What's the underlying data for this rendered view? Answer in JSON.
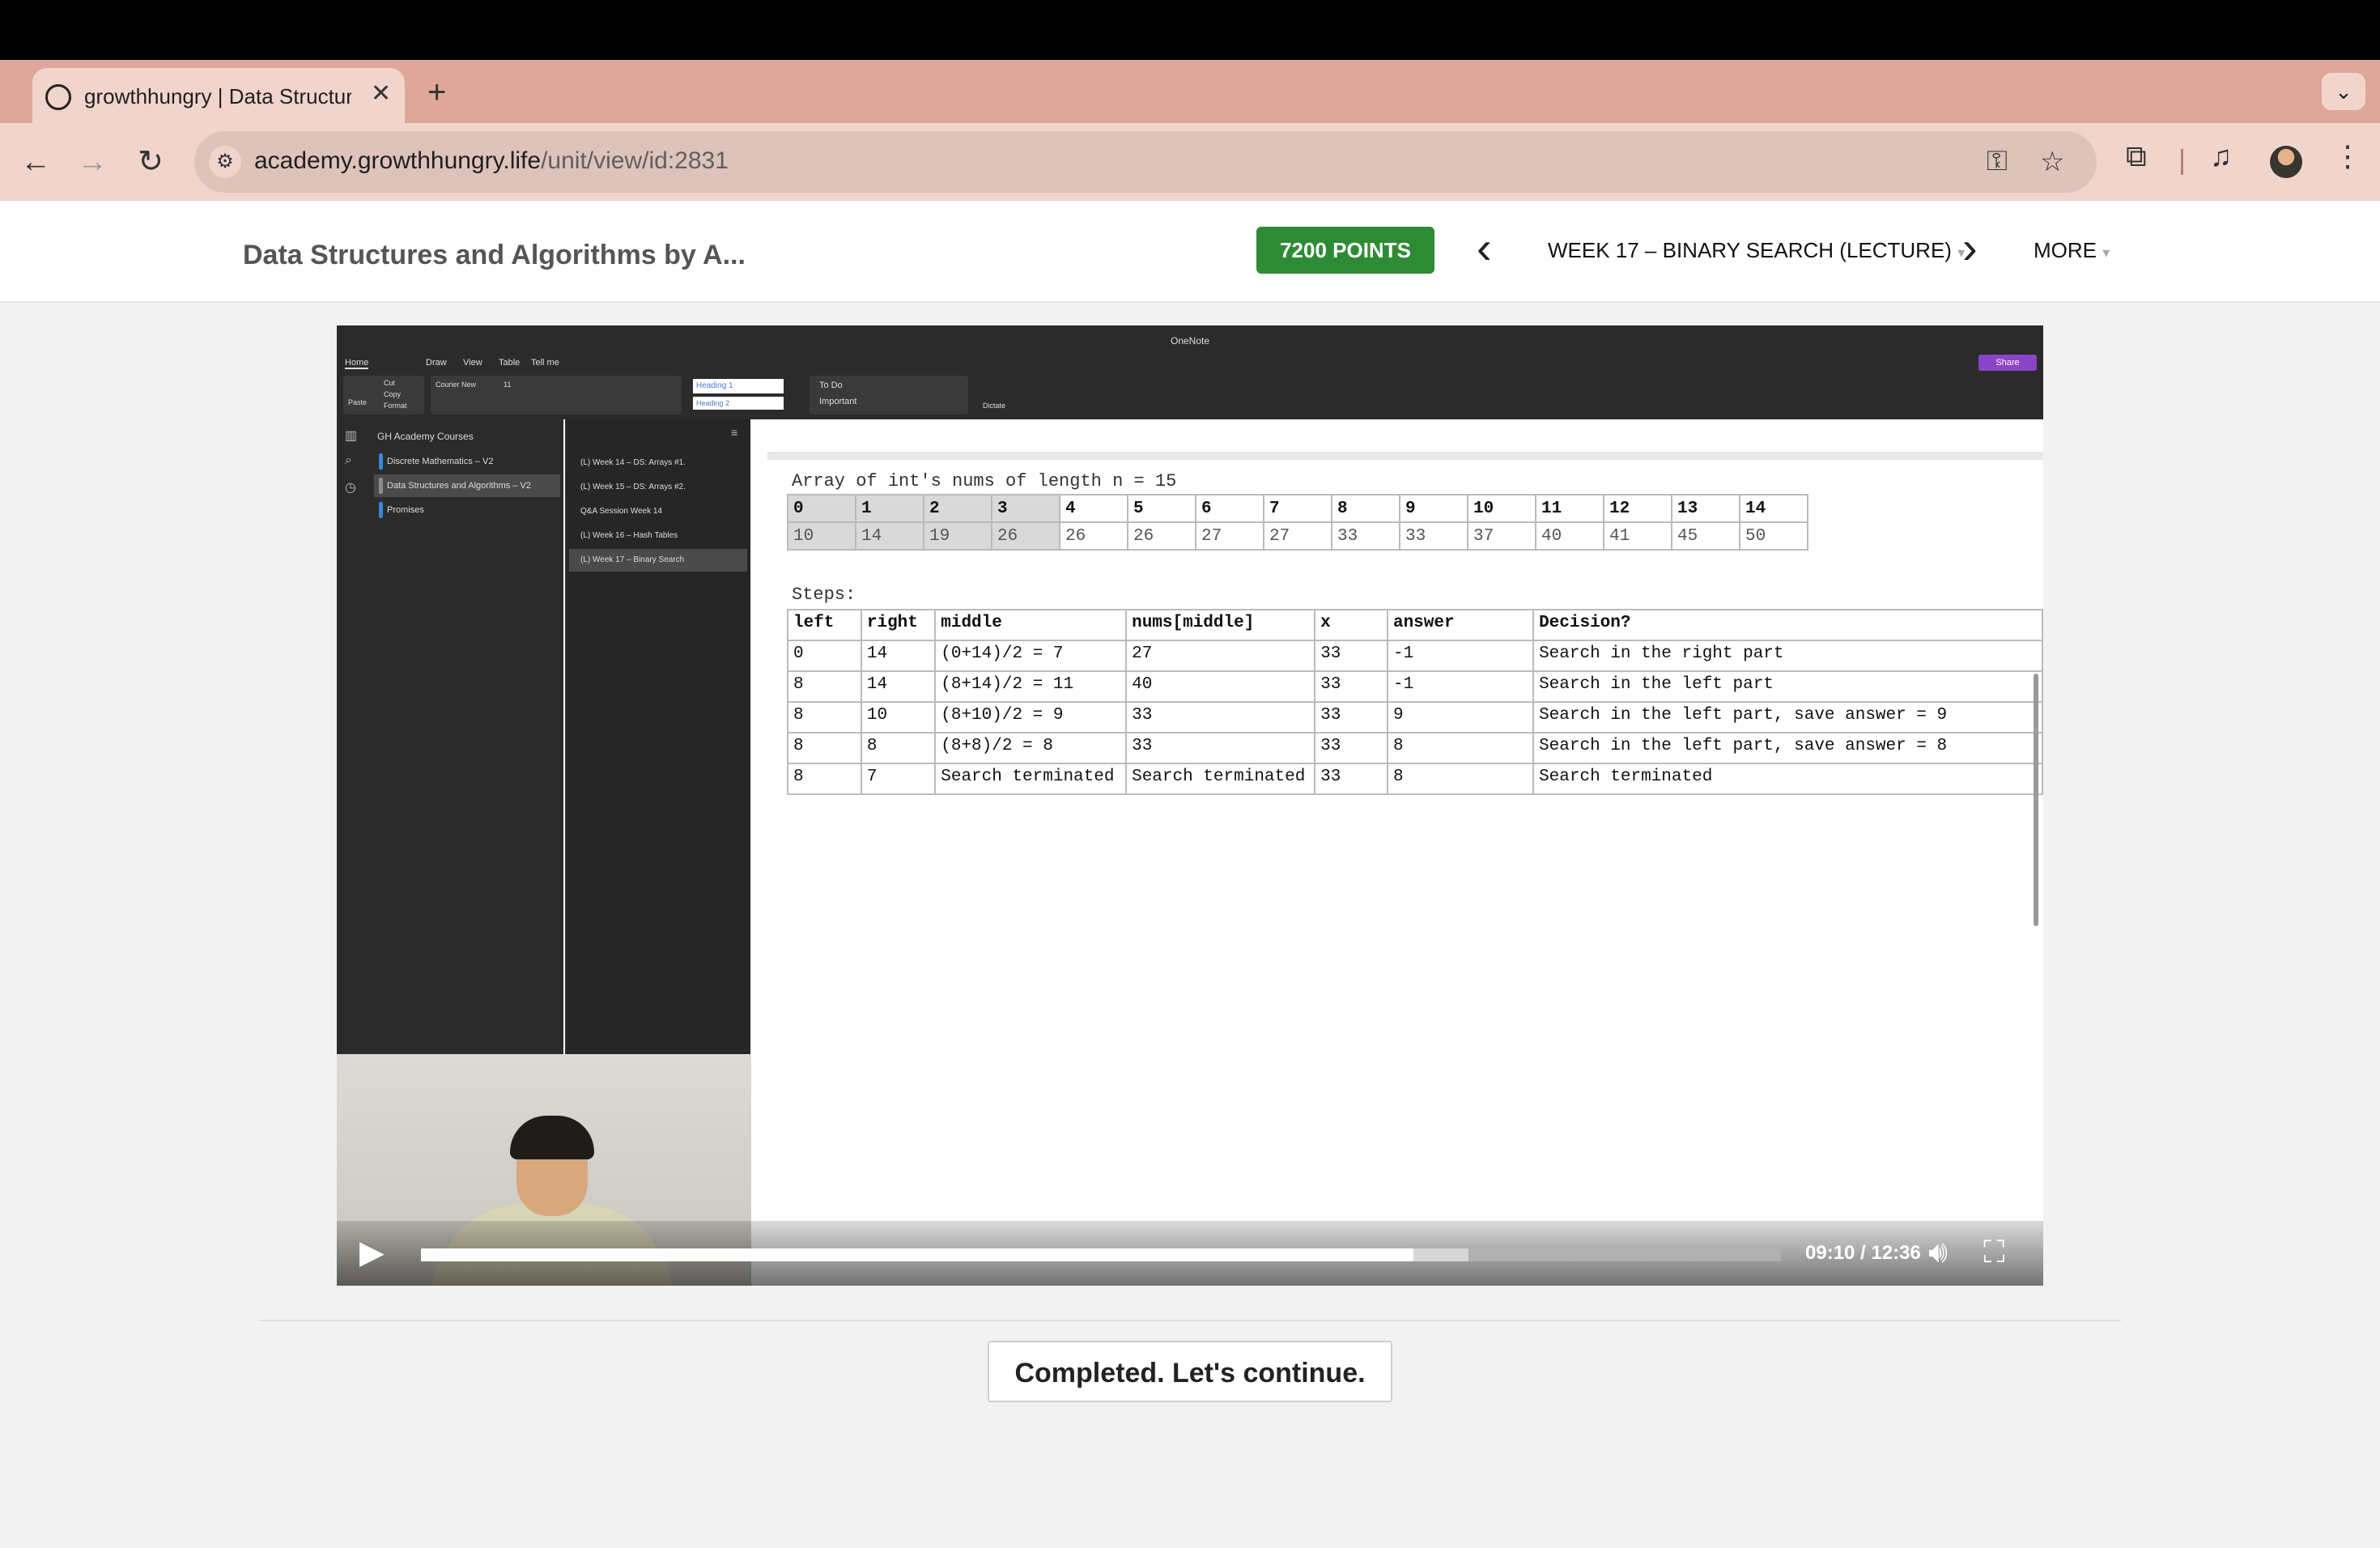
{
  "browser": {
    "tab_title": "growthhungry | Data Structures and Algorithms",
    "tab_close": "✕",
    "new_tab": "+",
    "tab_menu": "⌄",
    "url_host": "academy.growthhungry.life",
    "url_path": "/unit/view/id:2831"
  },
  "header": {
    "course_title": "Data Structures and Algorithms by A...",
    "points": "7200 POINTS",
    "prev": "‹",
    "next": "›",
    "lecture": "WEEK 17 – BINARY SEARCH (LECTURE)",
    "more": "MORE"
  },
  "onenote": {
    "app_title": "OneNote",
    "menu": [
      "Home",
      "Draw",
      "View",
      "Table",
      "Tell me"
    ],
    "paste": "Paste",
    "cut": "Cut",
    "copy": "Copy",
    "format": "Format",
    "font": "Courier New",
    "font_size": "11",
    "style1": "Heading 1",
    "style2": "Heading 2",
    "todo": "To Do",
    "important": "Important",
    "dictate": "Dictate",
    "share": "Share",
    "notebook": "GH Academy Courses",
    "sections": [
      {
        "label": "Discrete Mathematics – V2",
        "color": "#3a86d8"
      },
      {
        "label": "Data Structures and Algorithms – V2",
        "color": "#8c8c8c"
      },
      {
        "label": "Promises",
        "color": "#3a86d8"
      }
    ],
    "pages": [
      "(L) Week 14 – DS: Arrays #1.",
      "(L) Week 15 – DS: Arrays #2.",
      "Q&A Session Week 14",
      "(L) Week 16 – Hash Tables",
      "(L) Week 17 – Binary Search"
    ]
  },
  "note": {
    "caption": "Array of int's nums of length n = 15",
    "indices": [
      "0",
      "1",
      "2",
      "3",
      "4",
      "5",
      "6",
      "7",
      "8",
      "9",
      "10",
      "11",
      "12",
      "13",
      "14"
    ],
    "values": [
      "10",
      "14",
      "19",
      "26",
      "26",
      "26",
      "27",
      "27",
      "33",
      "33",
      "37",
      "40",
      "41",
      "45",
      "50"
    ],
    "steps_label": "Steps:",
    "steps_headers": [
      "left",
      "right",
      "middle",
      "nums[middle]",
      "x",
      "answer",
      "Decision?"
    ],
    "steps_rows": [
      [
        "0",
        "14",
        "(0+14)/2 = 7",
        "27",
        "33",
        "-1",
        "Search in the right part"
      ],
      [
        "8",
        "14",
        "(8+14)/2 = 11",
        "40",
        "33",
        "-1",
        "Search in the left part"
      ],
      [
        "8",
        "10",
        "(8+10)/2 = 9",
        "33",
        "33",
        "9",
        "Search in the left part, save answer = 9"
      ],
      [
        "8",
        "8",
        "(8+8)/2 = 8",
        "33",
        "33",
        "8",
        "Search in the left part, save answer = 8"
      ],
      [
        "8",
        "7",
        "Search terminated",
        "Search terminated",
        "33",
        "8",
        "Search terminated"
      ]
    ]
  },
  "video": {
    "time": "09:10 / 12:36",
    "progress": 0.73,
    "buffered": 0.77
  },
  "continue_label": "Completed. Let's continue."
}
